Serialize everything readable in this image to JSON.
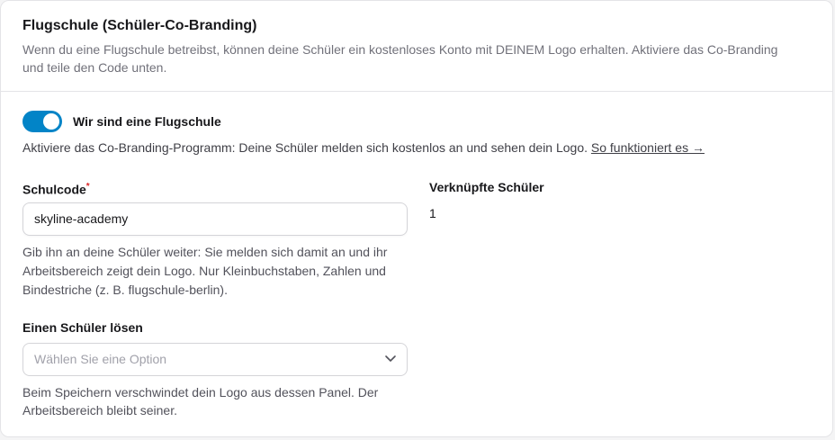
{
  "section": {
    "title": "Flugschule (Schüler-Co-Branding)",
    "description": "Wenn du eine Flugschule betreibst, können deine Schüler ein kostenloses Konto mit DEINEM Logo erhalten. Aktiviere das Co-Branding und teile den Code unten."
  },
  "toggle": {
    "label": "Wir sind eine Flugschule",
    "state": "on",
    "accent_color": "#0284c7"
  },
  "info": {
    "text": "Aktiviere das Co-Branding-Programm: Deine Schüler melden sich kostenlos an und sehen dein Logo.",
    "link_label": "So funktioniert es →"
  },
  "school_code": {
    "label": "Schulcode",
    "required_mark": "*",
    "value": "skyline-academy",
    "help": "Gib ihn an deine Schüler weiter: Sie melden sich damit an und ihr Arbeitsbereich zeigt dein Logo. Nur Kleinbuchstaben, Zahlen und Bindestriche (z. B. flugschule-berlin)."
  },
  "linked_students": {
    "label": "Verknüpfte Schüler",
    "value": "1"
  },
  "release_student": {
    "label": "Einen Schüler lösen",
    "placeholder": "Wählen Sie eine Option",
    "icon": "chevron-down-icon",
    "help": "Beim Speichern verschwindet dein Logo aus dessen Panel. Der Arbeitsbereich bleibt seiner."
  }
}
